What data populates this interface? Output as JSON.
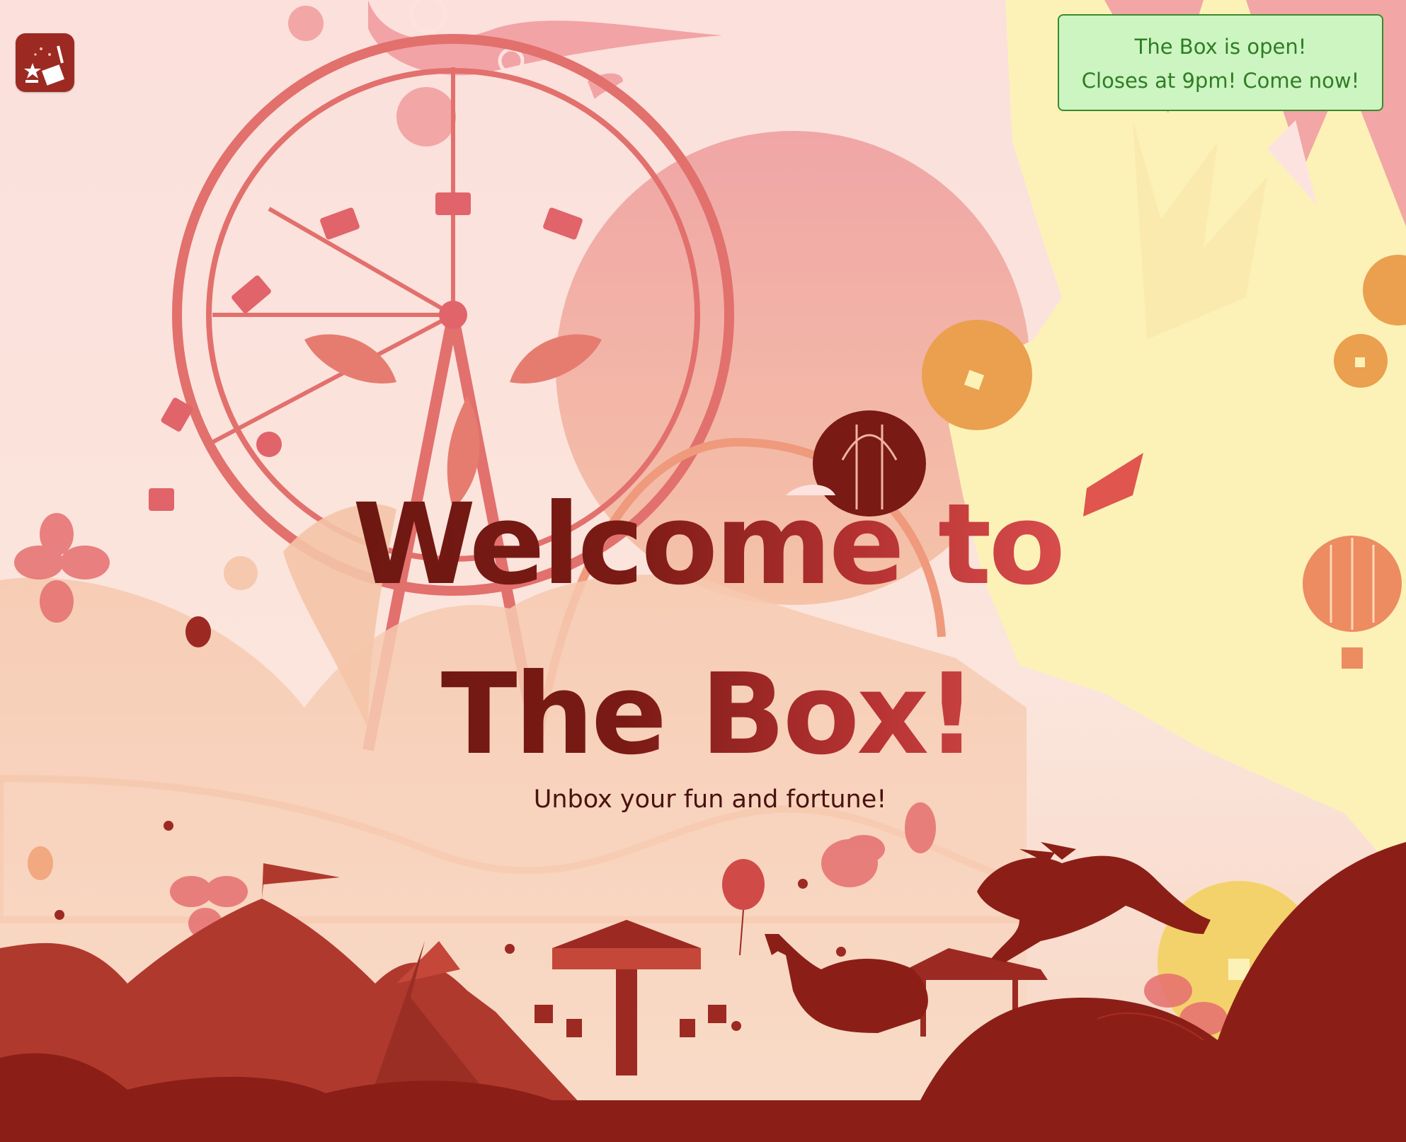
{
  "app": {
    "icon": "magic-box-icon"
  },
  "status": {
    "line1": "The Box is open!",
    "line2": "Closes at 9pm! Come now!"
  },
  "hero": {
    "title_line1": "Welcome to",
    "title_line2": "The Box!",
    "subtitle": "Unbox your fun and fortune!"
  },
  "colors": {
    "banner_bg": "#ccf5c2",
    "banner_text": "#2f7d24",
    "title_dark": "#6b1711",
    "title_light": "#e55656",
    "ground": "#8b1f17"
  }
}
